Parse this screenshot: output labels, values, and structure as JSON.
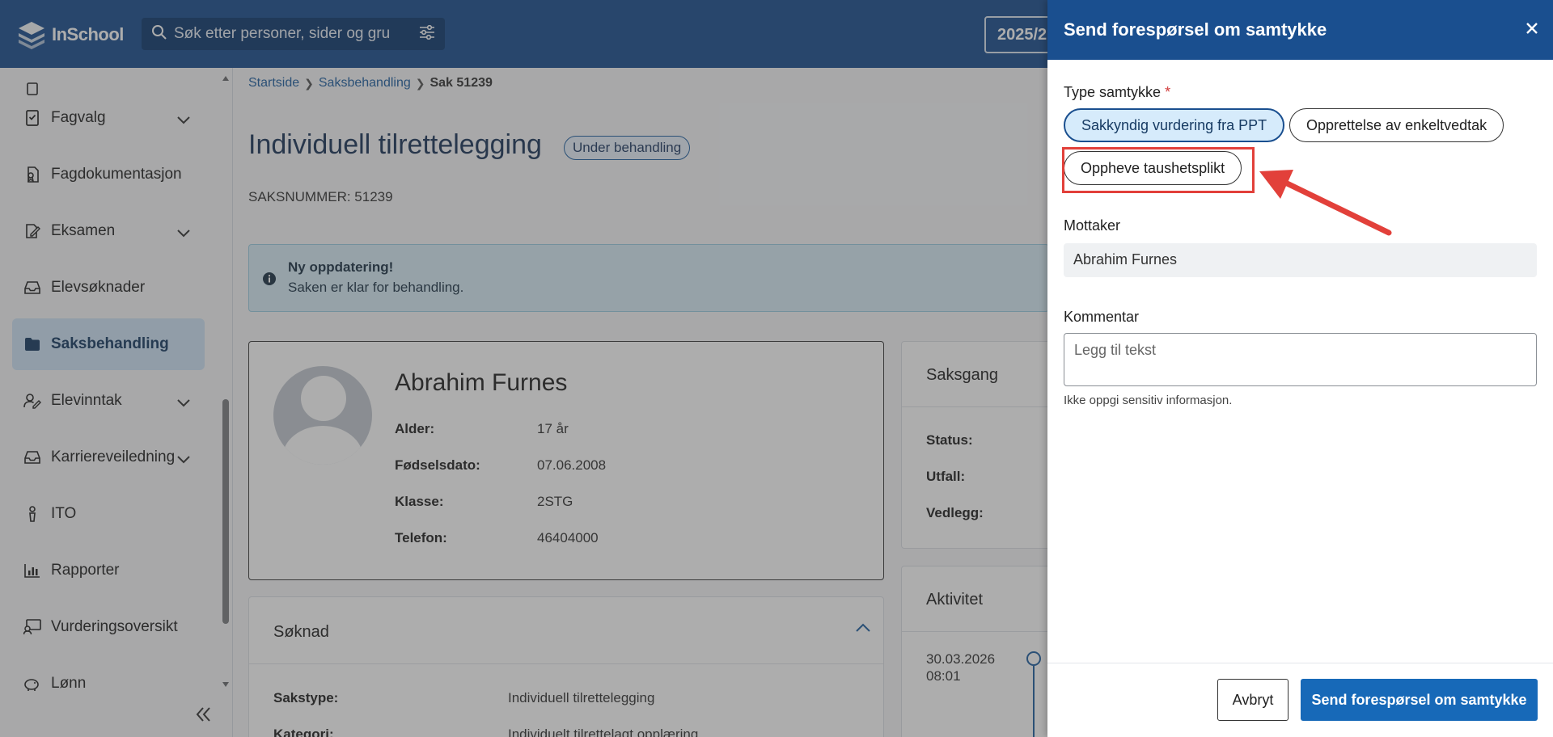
{
  "app": {
    "name": "InSchool",
    "search_placeholder": "Søk etter personer, sider og gru",
    "year_label": "2025/2"
  },
  "sidebar": {
    "items": [
      {
        "label": "Fagvalg",
        "icon": "book-check-icon",
        "has_chevron": true
      },
      {
        "label": "Fagdokumentasjon",
        "icon": "document-ribbon-icon",
        "has_chevron": false
      },
      {
        "label": "Eksamen",
        "icon": "exam-edit-icon",
        "has_chevron": true
      },
      {
        "label": "Elevsøknader",
        "icon": "inbox-icon",
        "has_chevron": false
      },
      {
        "label": "Saksbehandling",
        "icon": "folder-icon",
        "has_chevron": false,
        "active": true
      },
      {
        "label": "Elevinntak",
        "icon": "user-edit-icon",
        "has_chevron": true
      },
      {
        "label": "Karriereveiledning",
        "icon": "inbox-icon",
        "has_chevron": true
      },
      {
        "label": "ITO",
        "icon": "person-tie-icon",
        "has_chevron": false
      },
      {
        "label": "Rapporter",
        "icon": "bar-chart-icon",
        "has_chevron": false
      },
      {
        "label": "Vurderingsoversikt",
        "icon": "monitor-user-icon",
        "has_chevron": false
      },
      {
        "label": "Lønn",
        "icon": "piggy-bank-icon",
        "has_chevron": false
      }
    ]
  },
  "breadcrumb": {
    "home": "Startside",
    "section": "Saksbehandling",
    "current": "Sak 51239"
  },
  "case": {
    "title": "Individuell tilrettelegging",
    "status": "Under behandling",
    "case_number": "SAKSNUMMER: 51239"
  },
  "alert": {
    "title": "Ny oppdatering!",
    "text": "Saken er klar for behandling."
  },
  "person": {
    "name": "Abrahim Furnes",
    "rows": [
      {
        "label": "Alder:",
        "value": "17 år"
      },
      {
        "label": "Fødselsdato:",
        "value": "07.06.2008"
      },
      {
        "label": "Klasse:",
        "value": "2STG"
      },
      {
        "label": "Telefon:",
        "value": "46404000"
      }
    ]
  },
  "saksgang": {
    "title": "Saksgang",
    "rows": [
      "Status:",
      "Utfall:",
      "Vedlegg:"
    ]
  },
  "aktivitet": {
    "title": "Aktivitet",
    "date": "30.03.2026",
    "time": "08:01"
  },
  "soknad": {
    "title": "Søknad",
    "rows": [
      {
        "label": "Sakstype:",
        "value": "Individuell tilrettelegging"
      },
      {
        "label": "Kategori:",
        "value": "Individuelt tilrettelagt opplæring"
      }
    ]
  },
  "drawer": {
    "title": "Send forespørsel om samtykke",
    "type_label": "Type samtykke",
    "required_mark": "*",
    "options": [
      {
        "label": "Sakkyndig vurdering fra PPT",
        "selected": true
      },
      {
        "label": "Opprettelse av enkeltvedtak",
        "selected": false
      },
      {
        "label": "Oppheve taushetsplikt",
        "selected": false
      }
    ],
    "recipient_label": "Mottaker",
    "recipient_value": "Abrahim Furnes",
    "comment_label": "Kommentar",
    "comment_placeholder": "Legg til tekst",
    "helper": "Ikke oppgi sensitiv informasjon.",
    "cancel": "Avbryt",
    "submit": "Send forespørsel om samtykke"
  },
  "colors": {
    "header": "#1a4f8f",
    "accent": "#1769b8",
    "highlight": "#e2403a"
  }
}
